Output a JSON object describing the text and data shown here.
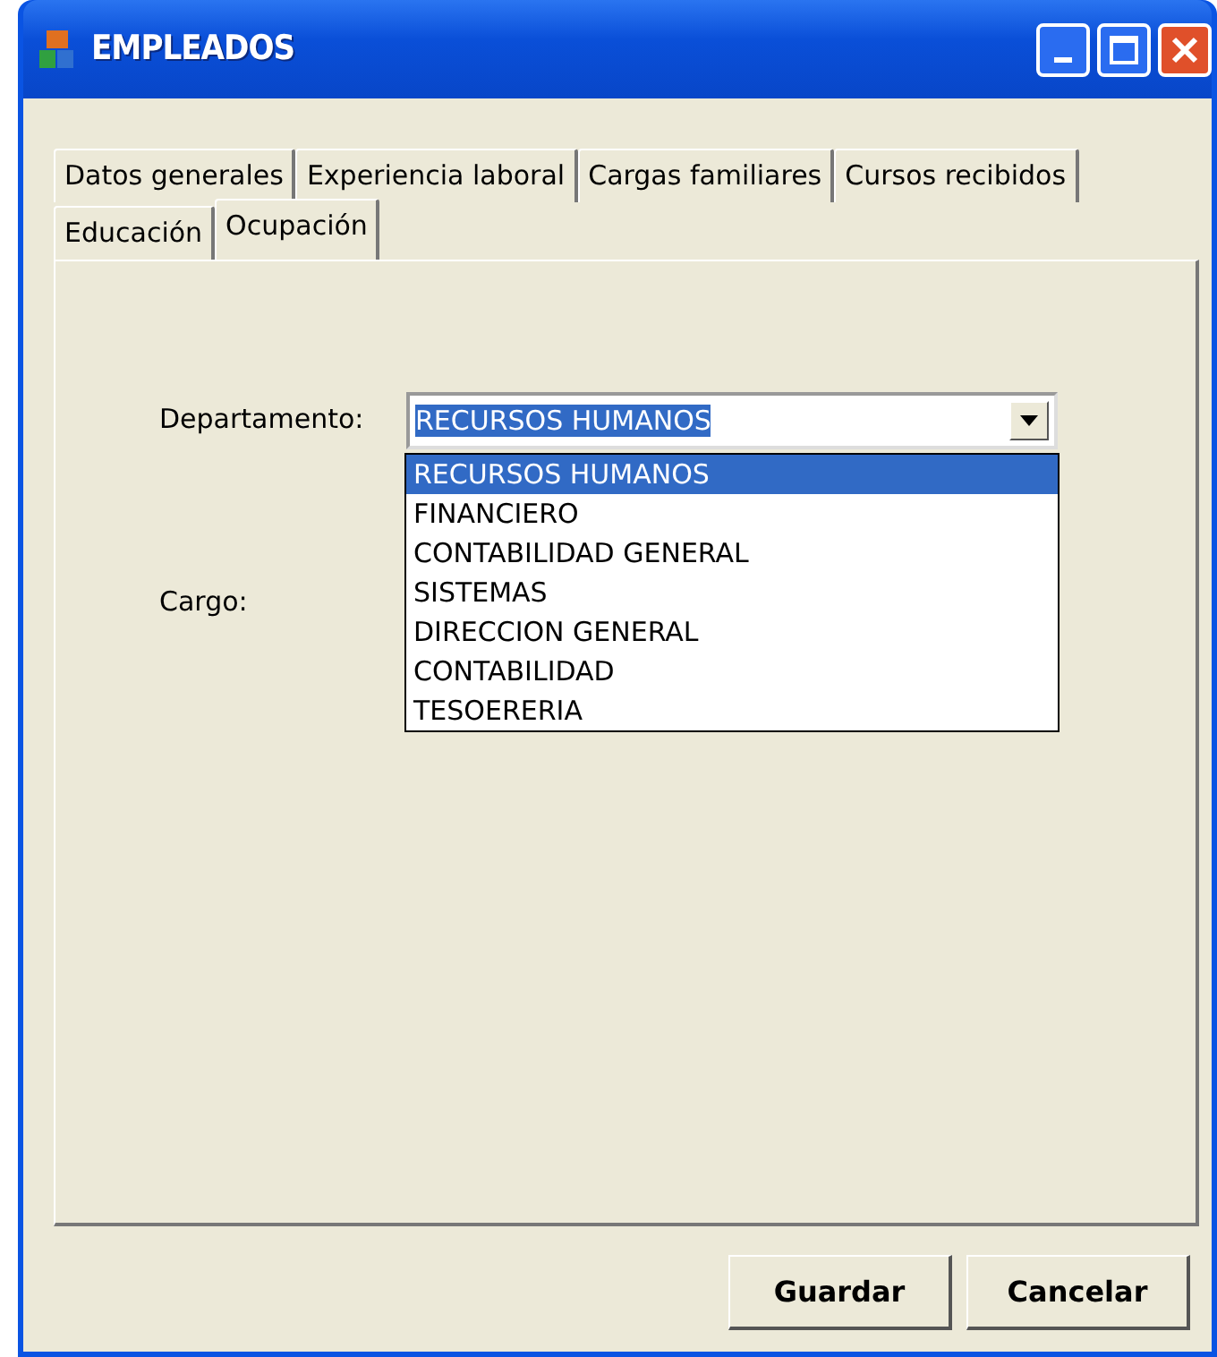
{
  "window": {
    "title": "EMPLEADOS"
  },
  "tab_rows": [
    [
      {
        "label": "Datos generales",
        "selected": false
      },
      {
        "label": "Experiencia laboral",
        "selected": false
      },
      {
        "label": "Cargas familiares",
        "selected": false
      },
      {
        "label": "Cursos recibidos",
        "selected": false
      }
    ],
    [
      {
        "label": "Educación",
        "selected": false
      },
      {
        "label": "Ocupación",
        "selected": true
      }
    ]
  ],
  "fields": [
    {
      "label": "Departamento:",
      "value": "RECURSOS HUMANOS",
      "expanded": true,
      "options": [
        {
          "label": "RECURSOS HUMANOS",
          "selected": true
        },
        {
          "label": "FINANCIERO",
          "selected": false
        },
        {
          "label": "CONTABILIDAD GENERAL",
          "selected": false
        },
        {
          "label": "SISTEMAS",
          "selected": false
        },
        {
          "label": "DIRECCION GENERAL",
          "selected": false
        },
        {
          "label": "CONTABILIDAD",
          "selected": false
        },
        {
          "label": "TESOERERIA",
          "selected": false
        }
      ]
    },
    {
      "label": "Cargo:"
    }
  ],
  "buttons": [
    "Guardar",
    "Cancelar"
  ]
}
